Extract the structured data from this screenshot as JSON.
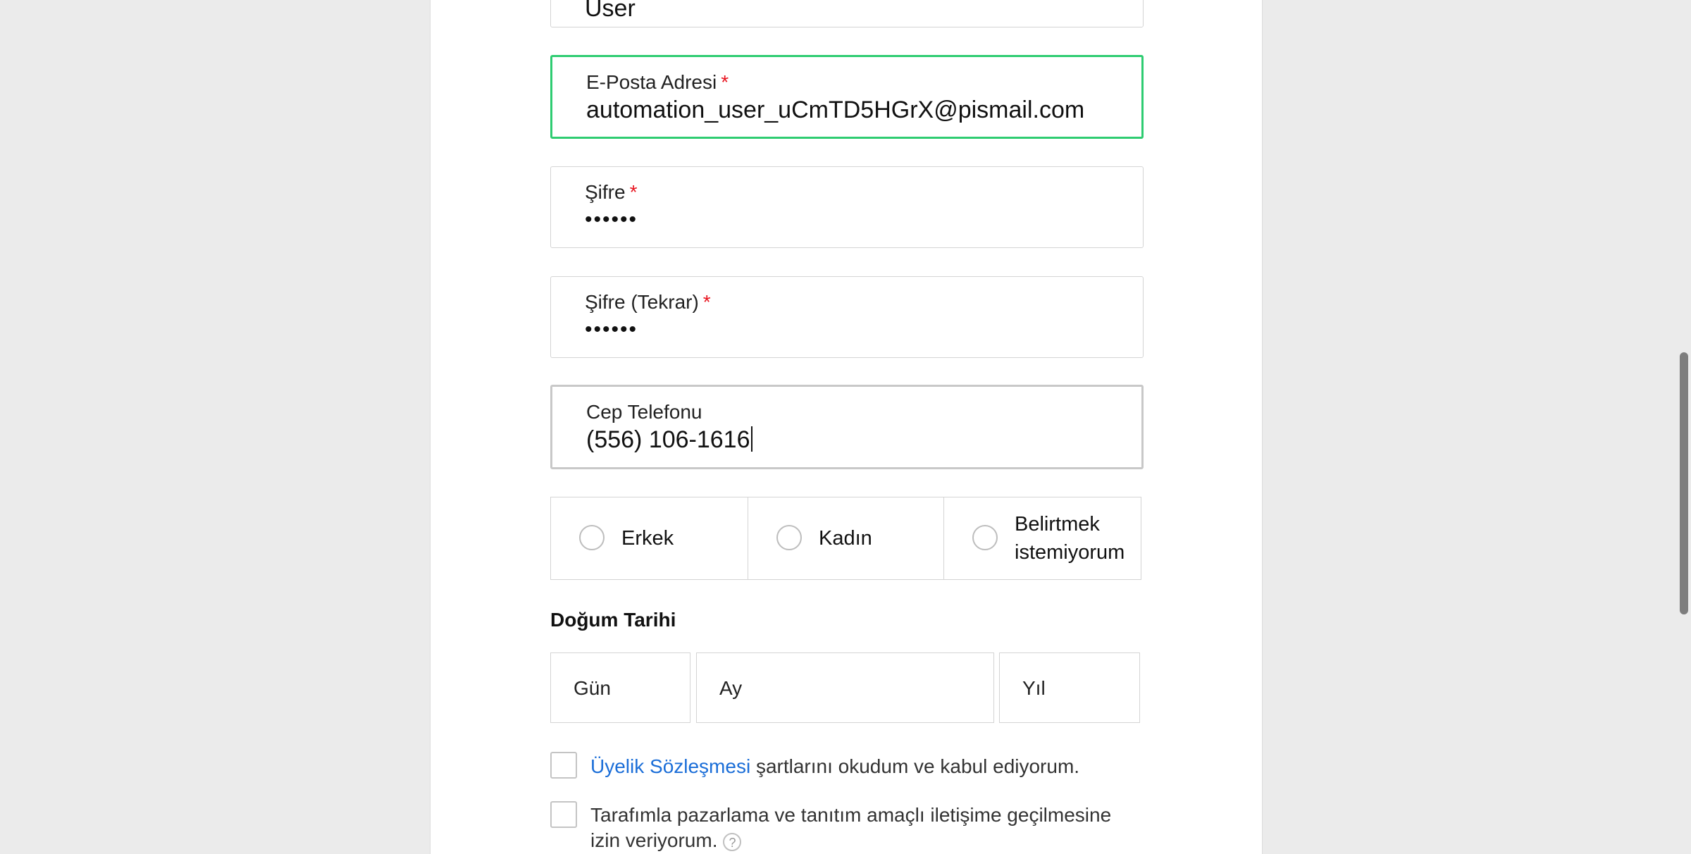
{
  "form": {
    "surname_value": "User",
    "email": {
      "label": "E-Posta Adresi",
      "required_mark": "*",
      "value": "automation_user_uCmTD5HGrX@pismail.com"
    },
    "password": {
      "label": "Şifre",
      "required_mark": "*",
      "value": "••••••"
    },
    "password_repeat": {
      "label": "Şifre (Tekrar)",
      "required_mark": "*",
      "value": "••••••"
    },
    "phone": {
      "label": "Cep Telefonu",
      "value": "(556) 106-1616"
    },
    "gender": {
      "options": [
        {
          "label": "Erkek"
        },
        {
          "label_line1": "Kadın"
        },
        {
          "label_line1": "Belirtmek",
          "label_line2": "istemiyorum"
        }
      ]
    },
    "birthdate": {
      "title": "Doğum Tarihi",
      "day_placeholder": "Gün",
      "month_placeholder": "Ay",
      "year_placeholder": "Yıl"
    },
    "agreement": {
      "link_text": "Üyelik Sözleşmesi",
      "rest_text": "şartlarını okudum ve kabul ediyorum."
    },
    "marketing": {
      "line1": "Tarafımla pazarlama ve tanıtım amaçlı iletişime geçilmesine",
      "line2": "izin veriyorum.",
      "help_icon_text": "?"
    }
  },
  "colors": {
    "focus_border": "#2ecc71",
    "required": "#e8141f",
    "link": "#1b6ed8"
  }
}
